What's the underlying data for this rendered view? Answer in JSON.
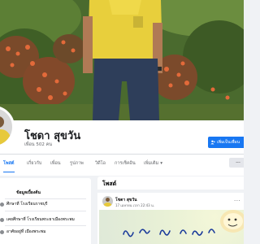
{
  "profile": {
    "name": "โชดา สุขวัน",
    "friends_count": "เพื่อน 502 คน"
  },
  "actions": {
    "add_friend_label": "เพิ่มเป็นเพื่อน"
  },
  "tabs": [
    {
      "label": "โพสต์",
      "active": true
    },
    {
      "label": "เกี่ยวกับ"
    },
    {
      "label": "เพื่อน"
    },
    {
      "label": "รูปภาพ"
    },
    {
      "label": "วิดีโอ"
    },
    {
      "label": "การเช็คอิน"
    },
    {
      "label": "เพิ่มเติม"
    }
  ],
  "intro": {
    "title": "ข้อมูลเบื้องต้น",
    "items": [
      "ศึกษาที่ โรงเรียนราชบุรี",
      "เคยศึกษาที่ โรงเรียนพระยาเมืองพระพม",
      "อาศัยอยู่ที่ เมืองพระพม"
    ]
  },
  "posts": {
    "title": "โพสต์",
    "author": "โชดา สุขวัน",
    "date": "17 เมษายน เวลา 22:43 น."
  },
  "colors": {
    "accent": "#1877f2",
    "background": "#f0f2f5"
  },
  "icons": {
    "add_friend": "add-person-icon",
    "more": "chevron-down-icon"
  }
}
